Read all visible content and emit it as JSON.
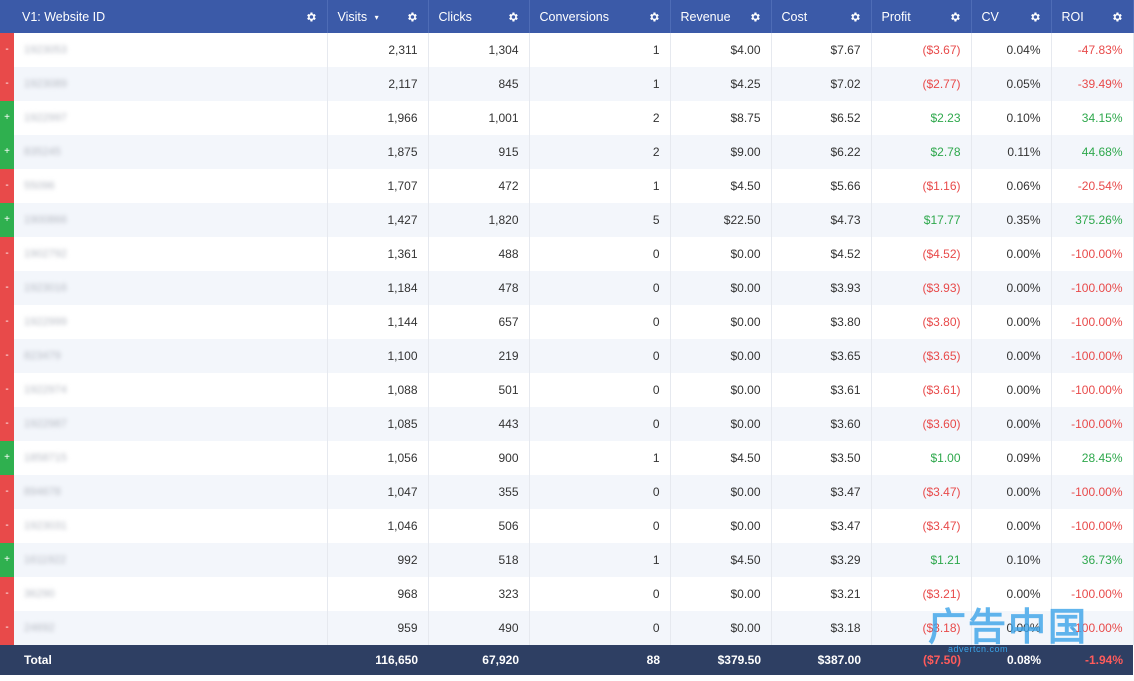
{
  "header": {
    "columns": [
      "V1: Website ID",
      "Visits",
      "Clicks",
      "Conversions",
      "Revenue",
      "Cost",
      "Profit",
      "CV",
      "ROI"
    ],
    "sort_indicator": "▾",
    "settings_icon": "gear-icon"
  },
  "rows": [
    {
      "status": "-",
      "id": "1923053",
      "visits": "2,311",
      "clicks": "1,304",
      "conversions": "1",
      "revenue": "$4.00",
      "cost": "$7.67",
      "profit": "($3.67)",
      "cv": "0.04%",
      "roi": "-47.83%",
      "positive": false
    },
    {
      "status": "-",
      "id": "1923089",
      "visits": "2,117",
      "clicks": "845",
      "conversions": "1",
      "revenue": "$4.25",
      "cost": "$7.02",
      "profit": "($2.77)",
      "cv": "0.05%",
      "roi": "-39.49%",
      "positive": false
    },
    {
      "status": "+",
      "id": "1922997",
      "visits": "1,966",
      "clicks": "1,001",
      "conversions": "2",
      "revenue": "$8.75",
      "cost": "$6.52",
      "profit": "$2.23",
      "cv": "0.10%",
      "roi": "34.15%",
      "positive": true
    },
    {
      "status": "+",
      "id": "835245",
      "visits": "1,875",
      "clicks": "915",
      "conversions": "2",
      "revenue": "$9.00",
      "cost": "$6.22",
      "profit": "$2.78",
      "cv": "0.11%",
      "roi": "44.68%",
      "positive": true
    },
    {
      "status": "-",
      "id": "55096",
      "visits": "1,707",
      "clicks": "472",
      "conversions": "1",
      "revenue": "$4.50",
      "cost": "$5.66",
      "profit": "($1.16)",
      "cv": "0.06%",
      "roi": "-20.54%",
      "positive": false
    },
    {
      "status": "+",
      "id": "1900866",
      "visits": "1,427",
      "clicks": "1,820",
      "conversions": "5",
      "revenue": "$22.50",
      "cost": "$4.73",
      "profit": "$17.77",
      "cv": "0.35%",
      "roi": "375.26%",
      "positive": true
    },
    {
      "status": "-",
      "id": "1902792",
      "visits": "1,361",
      "clicks": "488",
      "conversions": "0",
      "revenue": "$0.00",
      "cost": "$4.52",
      "profit": "($4.52)",
      "cv": "0.00%",
      "roi": "-100.00%",
      "positive": false
    },
    {
      "status": "-",
      "id": "1923016",
      "visits": "1,184",
      "clicks": "478",
      "conversions": "0",
      "revenue": "$0.00",
      "cost": "$3.93",
      "profit": "($3.93)",
      "cv": "0.00%",
      "roi": "-100.00%",
      "positive": false
    },
    {
      "status": "-",
      "id": "1922999",
      "visits": "1,144",
      "clicks": "657",
      "conversions": "0",
      "revenue": "$0.00",
      "cost": "$3.80",
      "profit": "($3.80)",
      "cv": "0.00%",
      "roi": "-100.00%",
      "positive": false
    },
    {
      "status": "-",
      "id": "823479",
      "visits": "1,100",
      "clicks": "219",
      "conversions": "0",
      "revenue": "$0.00",
      "cost": "$3.65",
      "profit": "($3.65)",
      "cv": "0.00%",
      "roi": "-100.00%",
      "positive": false
    },
    {
      "status": "-",
      "id": "1922974",
      "visits": "1,088",
      "clicks": "501",
      "conversions": "0",
      "revenue": "$0.00",
      "cost": "$3.61",
      "profit": "($3.61)",
      "cv": "0.00%",
      "roi": "-100.00%",
      "positive": false
    },
    {
      "status": "-",
      "id": "1922987",
      "visits": "1,085",
      "clicks": "443",
      "conversions": "0",
      "revenue": "$0.00",
      "cost": "$3.60",
      "profit": "($3.60)",
      "cv": "0.00%",
      "roi": "-100.00%",
      "positive": false
    },
    {
      "status": "+",
      "id": "1858715",
      "visits": "1,056",
      "clicks": "900",
      "conversions": "1",
      "revenue": "$4.50",
      "cost": "$3.50",
      "profit": "$1.00",
      "cv": "0.09%",
      "roi": "28.45%",
      "positive": true
    },
    {
      "status": "-",
      "id": "894678",
      "visits": "1,047",
      "clicks": "355",
      "conversions": "0",
      "revenue": "$0.00",
      "cost": "$3.47",
      "profit": "($3.47)",
      "cv": "0.00%",
      "roi": "-100.00%",
      "positive": false
    },
    {
      "status": "-",
      "id": "1923031",
      "visits": "1,046",
      "clicks": "506",
      "conversions": "0",
      "revenue": "$0.00",
      "cost": "$3.47",
      "profit": "($3.47)",
      "cv": "0.00%",
      "roi": "-100.00%",
      "positive": false
    },
    {
      "status": "+",
      "id": "1611922",
      "visits": "992",
      "clicks": "518",
      "conversions": "1",
      "revenue": "$4.50",
      "cost": "$3.29",
      "profit": "$1.21",
      "cv": "0.10%",
      "roi": "36.73%",
      "positive": true
    },
    {
      "status": "-",
      "id": "36290",
      "visits": "968",
      "clicks": "323",
      "conversions": "0",
      "revenue": "$0.00",
      "cost": "$3.21",
      "profit": "($3.21)",
      "cv": "0.00%",
      "roi": "-100.00%",
      "positive": false
    },
    {
      "status": "-",
      "id": "24692",
      "visits": "959",
      "clicks": "490",
      "conversions": "0",
      "revenue": "$0.00",
      "cost": "$3.18",
      "profit": "($3.18)",
      "cv": "0.00%",
      "roi": "-100.00%",
      "positive": false
    }
  ],
  "footer": {
    "label": "Total",
    "visits": "116,650",
    "clicks": "67,920",
    "conversions": "88",
    "revenue": "$379.50",
    "cost": "$387.00",
    "profit": "($7.50)",
    "cv": "0.08%",
    "roi": "-1.94%"
  },
  "colors": {
    "header_bg": "#3b5aa8",
    "footer_bg": "#2e3f63",
    "negative": "#e84a4a",
    "positive": "#2fb04f",
    "watermark": "#3aa3e8"
  },
  "watermark": {
    "logo": "广告中国",
    "url": "advertcn.com"
  }
}
